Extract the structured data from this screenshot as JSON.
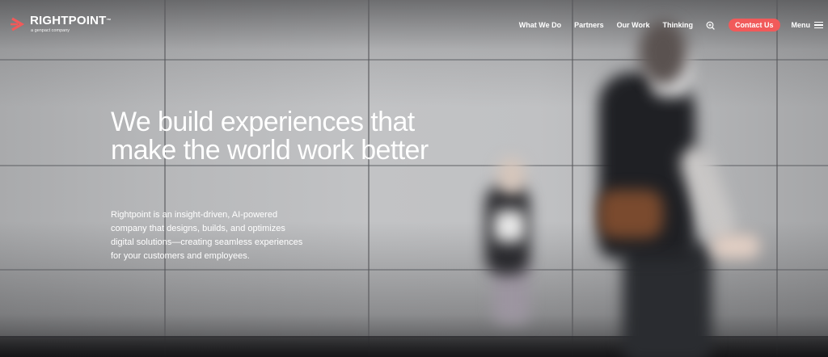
{
  "brand": {
    "name": "RIGHTPOINT",
    "trademark": "™",
    "tagline": "a genpact company",
    "accent_color": "#f15a5a"
  },
  "nav": {
    "links": [
      "What We Do",
      "Partners",
      "Our Work",
      "Thinking"
    ],
    "search_icon": "search-icon",
    "contact_label": "Contact Us",
    "menu_label": "Menu",
    "menu_icon": "hamburger-icon"
  },
  "hero": {
    "headline_lines": [
      "We build experiences that",
      "make the world work better"
    ],
    "body_lines": [
      "Rightpoint is an insight-driven, AI-powered",
      "company that designs, builds, and optimizes",
      "digital solutions—creating seamless experiences",
      "for your customers and employees."
    ],
    "background_image": "blurred people walking past a gray tiled wall"
  }
}
